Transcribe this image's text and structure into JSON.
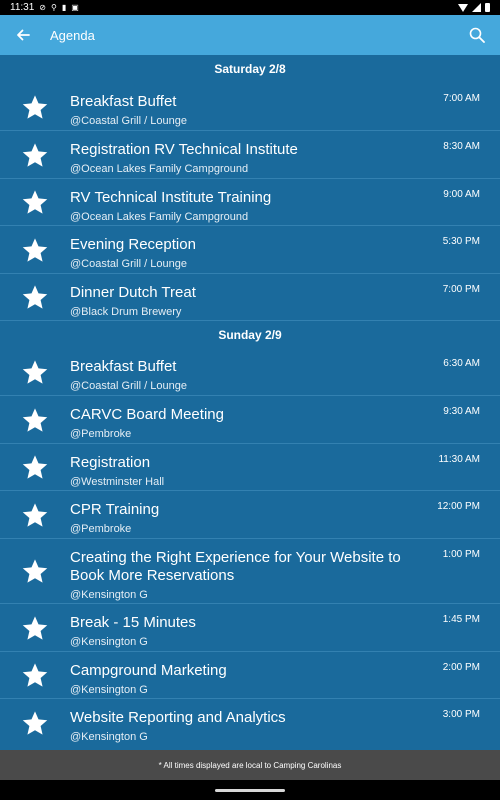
{
  "status_bar": {
    "time": "11:31"
  },
  "app_bar": {
    "title": "Agenda",
    "back_icon": "arrow-left-icon",
    "search_icon": "search-icon"
  },
  "days": [
    {
      "label": "Saturday 2/8",
      "sessions": [
        {
          "title": "Breakfast Buffet",
          "location": "@Coastal Grill / Lounge",
          "time": "7:00 AM"
        },
        {
          "title": "Registration RV Technical Institute",
          "location": "@Ocean Lakes Family Campground",
          "time": "8:30 AM"
        },
        {
          "title": "RV Technical Institute Training",
          "location": "@Ocean Lakes Family Campground",
          "time": "9:00 AM"
        },
        {
          "title": "Evening Reception",
          "location": "@Coastal Grill / Lounge",
          "time": "5:30 PM"
        },
        {
          "title": "Dinner Dutch Treat",
          "location": "@Black Drum Brewery",
          "time": "7:00 PM"
        }
      ]
    },
    {
      "label": "Sunday 2/9",
      "sessions": [
        {
          "title": "Breakfast Buffet",
          "location": "@Coastal Grill / Lounge",
          "time": "6:30 AM"
        },
        {
          "title": "CARVC Board Meeting",
          "location": "@Pembroke",
          "time": "9:30 AM"
        },
        {
          "title": "Registration",
          "location": "@Westminster Hall",
          "time": "11:30 AM"
        },
        {
          "title": "CPR Training",
          "location": "@Pembroke",
          "time": "12:00 PM"
        },
        {
          "title": "Creating the Right Experience for Your Website to Book More Reservations",
          "location": "@Kensington G",
          "time": "1:00 PM"
        },
        {
          "title": "Break - 15 Minutes",
          "location": "@Kensington G",
          "time": "1:45 PM"
        },
        {
          "title": "Campground Marketing",
          "location": "@Kensington G",
          "time": "2:00 PM"
        },
        {
          "title": "Website Reporting and Analytics",
          "location": "@Kensington G",
          "time": "3:00 PM"
        }
      ]
    }
  ],
  "footer": {
    "note": "* All times displayed are local to Camping Carolinas"
  },
  "colors": {
    "background": "#1a6a9c",
    "app_bar": "#45a8dc",
    "footer": "#4a4a4a"
  }
}
